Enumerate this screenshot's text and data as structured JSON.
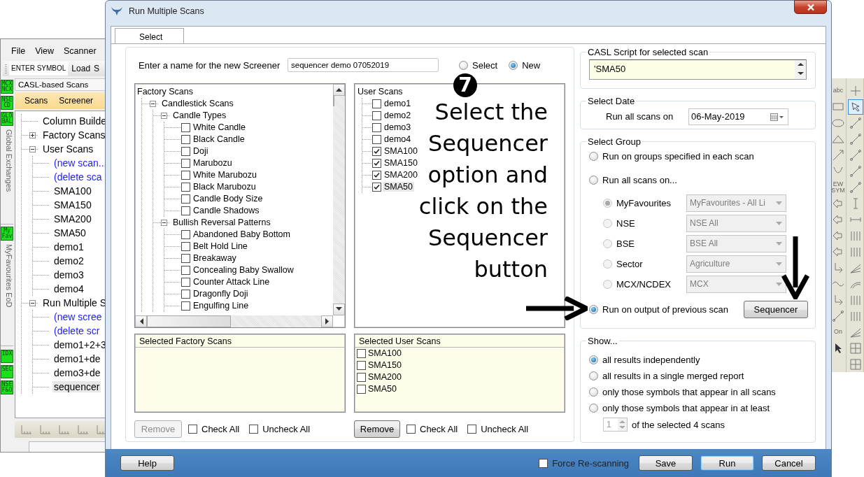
{
  "back_window": {
    "menu": [
      "File",
      "View",
      "Scanner"
    ],
    "symbol_field": {
      "value": "ENTER SYMBOL"
    },
    "toolbar_buttons": [
      "Load",
      "S"
    ],
    "side_tabs": [
      {
        "kind": "badge",
        "label": "MCX NCX"
      },
      {
        "kind": "badge",
        "label": "NSE CD"
      },
      {
        "kind": "badge",
        "label": "GLO BAL"
      },
      {
        "kind": "vertical",
        "label": "Global Exchanges"
      },
      {
        "kind": "badge",
        "label": "My Fav"
      },
      {
        "kind": "vertical",
        "label": "MyFavourites EoD"
      },
      {
        "kind": "badge",
        "label": "IDX"
      },
      {
        "kind": "badge",
        "label": "SEC"
      },
      {
        "kind": "badge",
        "label": "NSE F&O"
      }
    ],
    "panel_title": "CASL-based Scans",
    "panel_menu": [
      "Scans",
      "Screener"
    ],
    "tree": [
      {
        "label": "Column Builde",
        "selected": false
      },
      {
        "label": "Factory Scans",
        "expanded": false,
        "selected": false
      },
      {
        "label": "User Scans",
        "expanded": true,
        "selected": false,
        "children": [
          {
            "label": "(new scan...",
            "kind": "action",
            "selected": false
          },
          {
            "label": "(delete sca",
            "kind": "action",
            "selected": false
          },
          {
            "label": "SMA100",
            "kind": "item",
            "selected": false
          },
          {
            "label": "SMA150",
            "kind": "item",
            "selected": false
          },
          {
            "label": "SMA200",
            "kind": "item",
            "selected": false
          },
          {
            "label": "SMA50",
            "kind": "item",
            "selected": false
          },
          {
            "label": "demo1",
            "kind": "item",
            "selected": false
          },
          {
            "label": "demo2",
            "kind": "item",
            "selected": false
          },
          {
            "label": "demo3",
            "kind": "item",
            "selected": false
          },
          {
            "label": "demo4",
            "kind": "item",
            "selected": false
          }
        ]
      },
      {
        "label": "Run Multiple S",
        "expanded": true,
        "selected": false,
        "children": [
          {
            "label": "(new scree",
            "kind": "action",
            "selected": false
          },
          {
            "label": "(delete scr",
            "kind": "action",
            "selected": false
          },
          {
            "label": "demo1+2+3",
            "kind": "item",
            "selected": false
          },
          {
            "label": "demo1+de",
            "kind": "item",
            "selected": false
          },
          {
            "label": "demo3+de",
            "kind": "item",
            "selected": false
          },
          {
            "label": "sequencer",
            "kind": "item",
            "selected": true
          }
        ]
      }
    ]
  },
  "tool_strip": {
    "column_1": [
      {
        "kind": "text",
        "label": "abc"
      },
      {
        "kind": "rect"
      },
      {
        "kind": "ellipse"
      },
      {
        "kind": "triangle"
      },
      {
        "kind": "diagonal"
      },
      {
        "kind": "curve"
      },
      {
        "kind": "text",
        "label": "EW SYM"
      },
      {
        "kind": "arrowbox"
      },
      {
        "kind": "arrowbox"
      },
      {
        "kind": "arrowbox"
      },
      {
        "kind": "arrowbox"
      },
      {
        "kind": "hook"
      },
      {
        "kind": "wave"
      },
      {
        "kind": "hook"
      },
      {
        "kind": "line"
      },
      {
        "kind": "text",
        "label": "On"
      },
      {
        "kind": "pointer"
      }
    ],
    "column_2": [
      {
        "kind": "plus",
        "selected": false
      },
      {
        "kind": "cursor",
        "selected": true
      },
      {
        "kind": "line",
        "selected": false
      },
      {
        "kind": "line",
        "selected": false
      },
      {
        "kind": "line",
        "selected": false
      },
      {
        "kind": "line",
        "selected": false
      },
      {
        "kind": "line",
        "selected": false
      },
      {
        "kind": "vline",
        "selected": false
      },
      {
        "kind": "hline",
        "selected": false
      },
      {
        "kind": "bars",
        "selected": false
      },
      {
        "kind": "bars",
        "selected": false
      },
      {
        "kind": "fan",
        "selected": false
      },
      {
        "kind": "arc",
        "selected": false
      },
      {
        "kind": "bars",
        "selected": false
      },
      {
        "kind": "bars",
        "selected": false
      },
      {
        "kind": "fan",
        "selected": false
      },
      {
        "kind": "grid",
        "selected": false
      },
      {
        "kind": "grid",
        "selected": false
      }
    ]
  },
  "dialog": {
    "title": "Run Multiple Scans",
    "tabs": [
      {
        "label": "Select",
        "selected": true
      }
    ],
    "name_label": "Enter a name for the new Screener",
    "name_field": {
      "value": "sequencer demo 07052019"
    },
    "mode": [
      {
        "label": "Select",
        "selected": false
      },
      {
        "label": "New",
        "selected": true
      }
    ],
    "factory_tree": {
      "title": "Factory Scans",
      "children": [
        {
          "label": "Candlestick Scans",
          "expanded": true,
          "children": [
            {
              "label": "Candle Types",
              "expanded": true,
              "children": [
                {
                  "label": "White Candle",
                  "checked": false
                },
                {
                  "label": "Black Candle",
                  "checked": false
                },
                {
                  "label": "Doji",
                  "checked": false
                },
                {
                  "label": "Marubozu",
                  "checked": false
                },
                {
                  "label": "White Marubozu",
                  "checked": false
                },
                {
                  "label": "Black Marubozu",
                  "checked": false
                },
                {
                  "label": "Candle Body Size",
                  "checked": false
                },
                {
                  "label": "Candle Shadows",
                  "checked": false
                }
              ]
            },
            {
              "label": "Bullish Reversal Patterns",
              "expanded": true,
              "children": [
                {
                  "label": "Abandoned Baby Bottom",
                  "checked": false
                },
                {
                  "label": "Belt Hold Line",
                  "checked": false
                },
                {
                  "label": "Breakaway",
                  "checked": false
                },
                {
                  "label": "Concealing Baby Swallow",
                  "checked": false
                },
                {
                  "label": "Counter Attack Line",
                  "checked": false
                },
                {
                  "label": "Dragonfly Doji",
                  "checked": false
                },
                {
                  "label": "Engulfing Line",
                  "checked": false
                }
              ]
            }
          ]
        }
      ]
    },
    "user_tree": {
      "title": "User Scans",
      "items": [
        {
          "label": "demo1",
          "checked": false,
          "selected": false
        },
        {
          "label": "demo2",
          "checked": false,
          "selected": false
        },
        {
          "label": "demo3",
          "checked": false,
          "selected": false
        },
        {
          "label": "demo4",
          "checked": false,
          "selected": false
        },
        {
          "label": "SMA100",
          "checked": true,
          "selected": false
        },
        {
          "label": "SMA150",
          "checked": true,
          "selected": false
        },
        {
          "label": "SMA200",
          "checked": true,
          "selected": false
        },
        {
          "label": "SMA50",
          "checked": true,
          "selected": true
        }
      ]
    },
    "selected_factory": {
      "title": "Selected Factory Scans"
    },
    "selected_user": {
      "title": "Selected User Scans",
      "items": [
        {
          "label": "SMA100",
          "checked": false
        },
        {
          "label": "SMA150",
          "checked": false
        },
        {
          "label": "SMA200",
          "checked": false
        },
        {
          "label": "SMA50",
          "checked": false
        }
      ]
    },
    "factory_actions": {
      "remove": {
        "label": "Remove",
        "disabled": true
      },
      "check_all": {
        "label": "Check All",
        "checked": false
      },
      "uncheck_all": {
        "label": "Uncheck All",
        "checked": false
      }
    },
    "user_actions": {
      "remove": {
        "label": "Remove",
        "disabled": false
      },
      "check_all": {
        "label": "Check All",
        "checked": false
      },
      "uncheck_all": {
        "label": "Uncheck All",
        "checked": false
      }
    },
    "script": {
      "title": "CASL Script for selected scan",
      "value": "'SMA50"
    },
    "date": {
      "title": "Select Date",
      "label": "Run all scans on",
      "value": "06-May-2019"
    },
    "group": {
      "title": "Select Group",
      "rows": [
        {
          "kind": "option",
          "label": "Run on groups specified in each scan",
          "selected": false
        },
        {
          "kind": "option",
          "label": "Run all scans on...",
          "selected": false
        },
        {
          "kind": "exchange",
          "label": "MyFavourites",
          "selected": true,
          "disabled": true,
          "value": "MyFavourites - All Li"
        },
        {
          "kind": "exchange",
          "label": "NSE",
          "selected": false,
          "disabled": true,
          "value": "NSE All"
        },
        {
          "kind": "exchange",
          "label": "BSE",
          "selected": false,
          "disabled": true,
          "value": "BSE All"
        },
        {
          "kind": "exchange",
          "label": "Sector",
          "selected": false,
          "disabled": true,
          "value": "Agriculture"
        },
        {
          "kind": "exchange",
          "label": "MCX/NCDEX",
          "selected": false,
          "disabled": true,
          "value": "MCX"
        },
        {
          "kind": "option",
          "label": "Run on output of previous scan",
          "selected": true,
          "button": "Sequencer"
        }
      ]
    },
    "show": {
      "title": "Show...",
      "options": [
        {
          "label": "all results independently",
          "selected": true
        },
        {
          "label": "all results in a single merged report",
          "selected": false
        },
        {
          "label": "only those symbols that appear in all scans",
          "selected": false
        },
        {
          "label": "only those symbols that appear in at least",
          "selected": false
        }
      ],
      "spinner": {
        "value": "1",
        "disabled": true
      },
      "suffix": "of the selected 4 scans"
    },
    "footer": {
      "help": "Help",
      "force": {
        "label": "Force Re-scanning",
        "checked": false
      },
      "buttons": [
        {
          "label": "Save",
          "default": false
        },
        {
          "label": "Run",
          "default": true
        },
        {
          "label": "Cancel",
          "default": false
        }
      ]
    }
  },
  "annotation": {
    "step": "7",
    "text": "Select the Sequencer option and click on the Sequencer button"
  }
}
